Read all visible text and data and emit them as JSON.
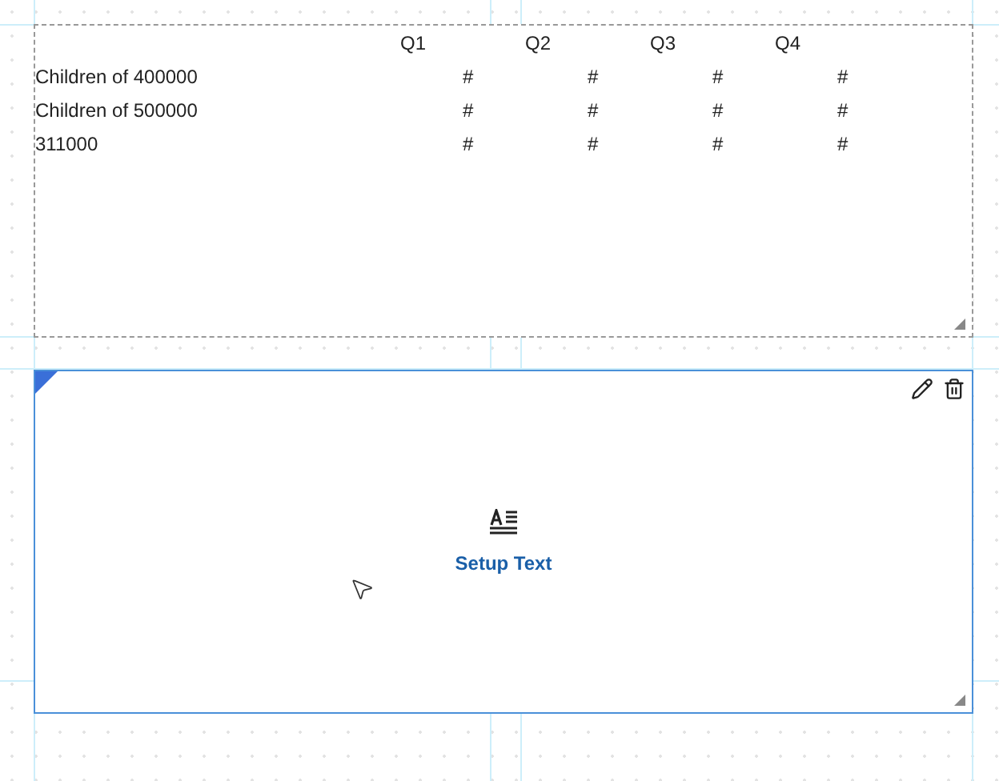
{
  "table_widget": {
    "selected": false,
    "columns": [
      "Q1",
      "Q2",
      "Q3",
      "Q4"
    ],
    "rows": [
      {
        "label": "Children of 400000",
        "cells": [
          "#",
          "#",
          "#",
          "#"
        ]
      },
      {
        "label": "Children of 500000",
        "cells": [
          "#",
          "#",
          "#",
          "#"
        ]
      },
      {
        "label": "311000",
        "cells": [
          "#",
          "#",
          "#",
          "#"
        ]
      }
    ]
  },
  "text_widget": {
    "selected": true,
    "label": "Setup Text"
  }
}
